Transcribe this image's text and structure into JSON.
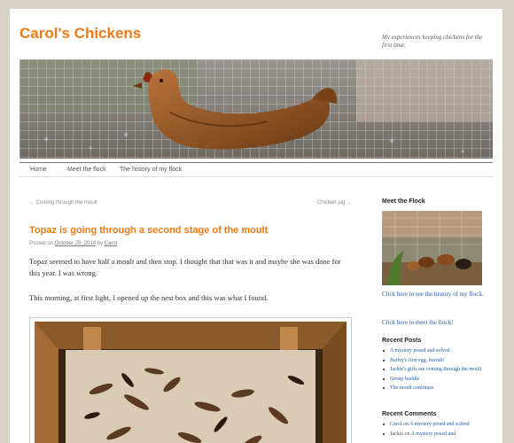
{
  "site": {
    "title": "Carol's Chickens",
    "description": "My experiences keeping chickens for the first time."
  },
  "menu": {
    "items": [
      "Home",
      "Meet the flock",
      "The history of my flock"
    ]
  },
  "post_nav": {
    "previous": "← Coming through the moult",
    "next": "Chicken jug →"
  },
  "post": {
    "title": "Topaz is going through a second stage of the moult",
    "posted_on_label": "Posted on",
    "date": "October 25, 2014",
    "by_label": "by",
    "author": "Carol",
    "paragraphs": [
      "Topaz seemed to have half a moult and then stop. I thought that that was it and maybe she was done for this year. I was wrong.",
      "This morning, at first light, I opened up the nest box and this was what I found."
    ]
  },
  "sidebar": {
    "meet_heading": "Meet the Flock",
    "history_link": "Click here to see the history of my flock.",
    "meet_link": "Click here to meet the flock!",
    "recent_posts_heading": "Recent Posts",
    "recent_posts": [
      "A mystery posed and solved",
      "Barley's first egg, hurrah!",
      "Jackie's girls are coming through the moult",
      "Group huddle",
      "The moult continues"
    ],
    "recent_comments_heading": "Recent Comments",
    "recent_comments": [
      {
        "author": "Carol",
        "on": "on",
        "post": "A mystery posed and solved"
      },
      {
        "author": "Jackie",
        "on": "on",
        "post": "A mystery posed and"
      }
    ]
  },
  "colors": {
    "title_orange": "#ef7a17",
    "link_blue": "#1b5ea8",
    "page_background": "#d8d2c4"
  }
}
